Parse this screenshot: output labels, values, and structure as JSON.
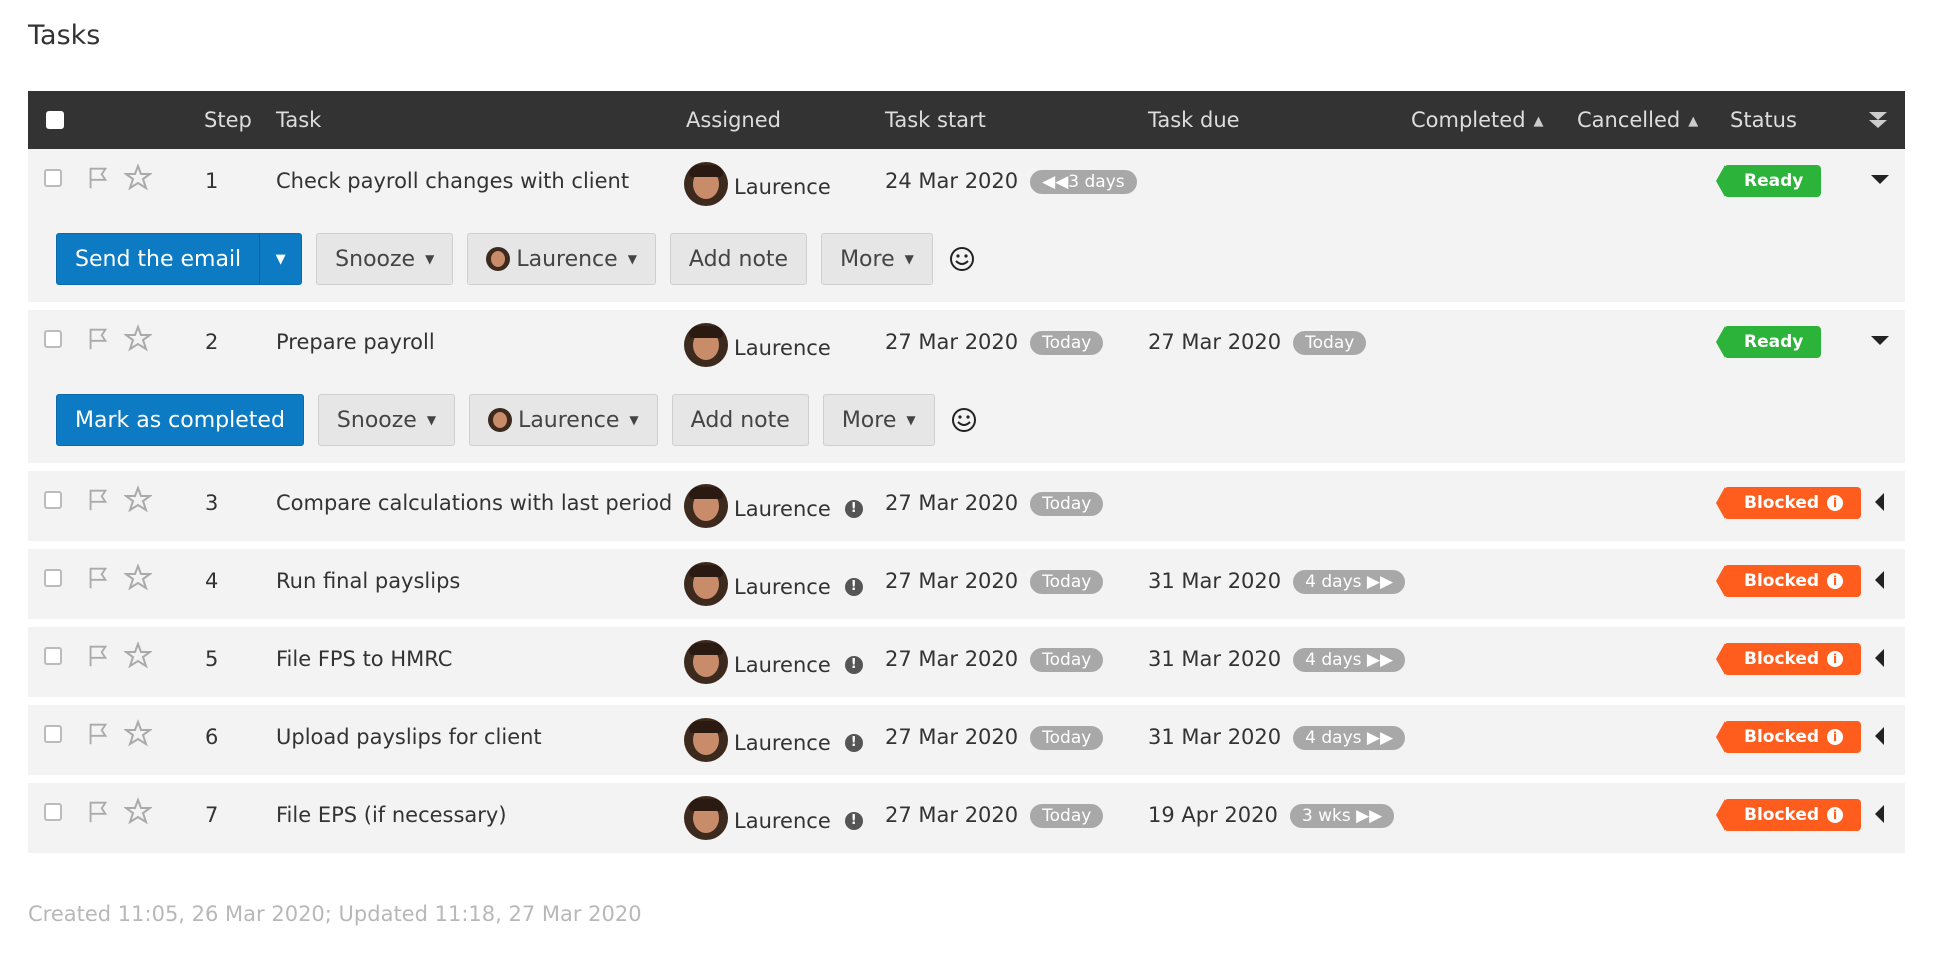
{
  "page": {
    "title": "Tasks"
  },
  "table": {
    "headers": {
      "step": "Step",
      "task": "Task",
      "assigned": "Assigned",
      "task_start": "Task start",
      "task_due": "Task due",
      "completed": "Completed",
      "cancelled": "Cancelled",
      "status": "Status"
    },
    "rows": [
      {
        "step": "1",
        "task": "Check payroll changes with client",
        "assigned": "Laurence",
        "start": "24 Mar 2020",
        "start_badge": "◀◀3 days",
        "due": "",
        "due_badge": "",
        "status": "Ready",
        "status_kind": "ready",
        "expanded": true,
        "actions": {
          "primary": "Send the email",
          "snooze": "Snooze",
          "assignee": "Laurence",
          "note": "Add note",
          "more": "More"
        }
      },
      {
        "step": "2",
        "task": "Prepare payroll",
        "assigned": "Laurence",
        "start": "27 Mar 2020",
        "start_badge": "Today",
        "due": "27 Mar 2020",
        "due_badge": "Today",
        "status": "Ready",
        "status_kind": "ready",
        "expanded": true,
        "actions": {
          "primary": "Mark as completed",
          "snooze": "Snooze",
          "assignee": "Laurence",
          "note": "Add note",
          "more": "More"
        }
      },
      {
        "step": "3",
        "task": "Compare calculations with last period",
        "assigned": "Laurence",
        "start": "27 Mar 2020",
        "start_badge": "Today",
        "due": "",
        "due_badge": "",
        "status": "Blocked",
        "status_kind": "blocked",
        "expanded": false
      },
      {
        "step": "4",
        "task": "Run final payslips",
        "assigned": "Laurence",
        "start": "27 Mar 2020",
        "start_badge": "Today",
        "due": "31 Mar 2020",
        "due_badge": "4 days ▶▶",
        "status": "Blocked",
        "status_kind": "blocked",
        "expanded": false
      },
      {
        "step": "5",
        "task": "File FPS to HMRC",
        "assigned": "Laurence",
        "start": "27 Mar 2020",
        "start_badge": "Today",
        "due": "31 Mar 2020",
        "due_badge": "4 days ▶▶",
        "status": "Blocked",
        "status_kind": "blocked",
        "expanded": false
      },
      {
        "step": "6",
        "task": "Upload payslips for client",
        "assigned": "Laurence",
        "start": "27 Mar 2020",
        "start_badge": "Today",
        "due": "31 Mar 2020",
        "due_badge": "4 days ▶▶",
        "status": "Blocked",
        "status_kind": "blocked",
        "expanded": false
      },
      {
        "step": "7",
        "task": "File EPS (if necessary)",
        "assigned": "Laurence",
        "start": "27 Mar 2020",
        "start_badge": "Today",
        "due": "19 Apr 2020",
        "due_badge": "3 wks ▶▶",
        "status": "Blocked",
        "status_kind": "blocked",
        "expanded": false
      }
    ]
  },
  "footer": {
    "meta": "Created 11:05, 26 Mar 2020; Updated 11:18, 27 Mar 2020"
  },
  "colors": {
    "header_bg": "#333333",
    "primary": "#0d7bc4",
    "ready": "#2bb33a",
    "blocked": "#ff5d1d",
    "badge": "#a8a8a8"
  },
  "icons": [
    "checkbox-icon",
    "flag-icon",
    "star-icon",
    "avatar",
    "warning-icon",
    "info-icon",
    "caret-down-icon",
    "caret-left-icon",
    "sort-icon",
    "smiley-icon"
  ]
}
